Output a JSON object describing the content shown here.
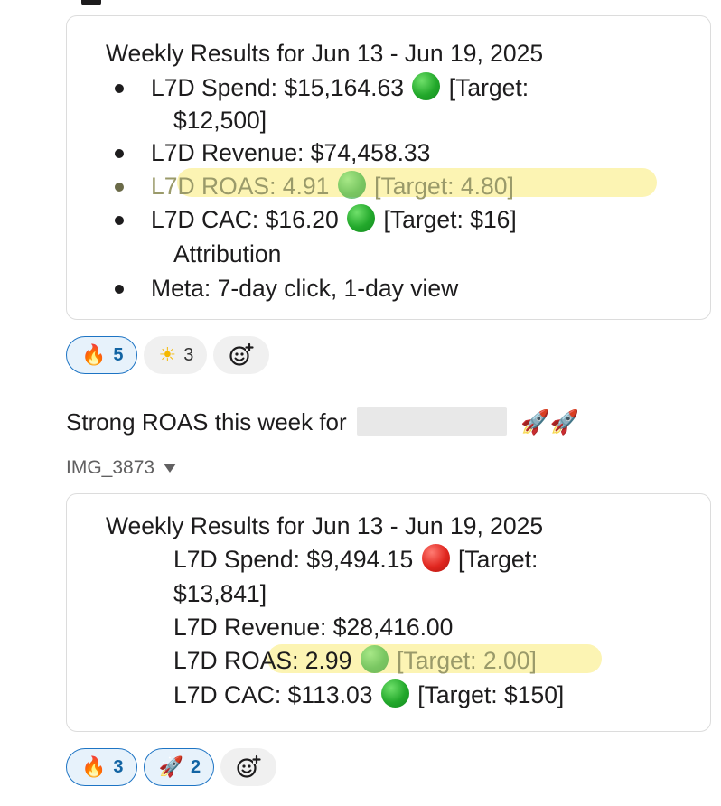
{
  "card1": {
    "title": "Weekly Results for Jun 13 - Jun 19, 2025",
    "spend": {
      "label": "L7D Spend: $15,164.63",
      "status": "green",
      "target": "[Target:",
      "target_cont": "$12,500]"
    },
    "revenue": "L7D Revenue: $74,458.33",
    "roas": {
      "label": "L7D ROAS: 4.91",
      "status": "green",
      "target": "[Target: 4.80]"
    },
    "cac": {
      "label": "L7D CAC: $16.20",
      "status": "green",
      "target": "[Target: $16]"
    },
    "attribution_heading": "Attribution",
    "attribution_item": "Meta: 7-day click, 1-day view"
  },
  "reactions1": [
    {
      "icon": "fire-emoji",
      "glyph": "🔥",
      "count": "5",
      "active": true
    },
    {
      "icon": "sun-emoji",
      "glyph": "☀",
      "count": "3",
      "active": false
    }
  ],
  "message": {
    "text": "Strong ROAS this week for",
    "suffix": "🚀🚀"
  },
  "file": {
    "name": "IMG_3873"
  },
  "card2": {
    "title": "Weekly Results for Jun 13 - Jun 19, 2025",
    "spend": {
      "label": "L7D Spend: $9,494.15",
      "status": "red",
      "target": "[Target:",
      "target_cont": "$13,841]"
    },
    "revenue": "L7D Revenue: $28,416.00",
    "roas": {
      "label": "L7D ROAS: 2.99",
      "status": "green",
      "target": "[Target: 2.00]"
    },
    "cac": {
      "label": "L7D CAC: $113.03",
      "status": "green",
      "target": "[Target: $150]"
    }
  },
  "reactions2": [
    {
      "icon": "fire-emoji",
      "glyph": "🔥",
      "count": "3",
      "active": true
    },
    {
      "icon": "rocket-emoji",
      "glyph": "🚀",
      "count": "2",
      "active": true
    }
  ],
  "colors": {
    "accent": "#1264a3",
    "highlight": "#fbf2a6",
    "status_green": "#22a82b",
    "status_red": "#e0261f"
  }
}
